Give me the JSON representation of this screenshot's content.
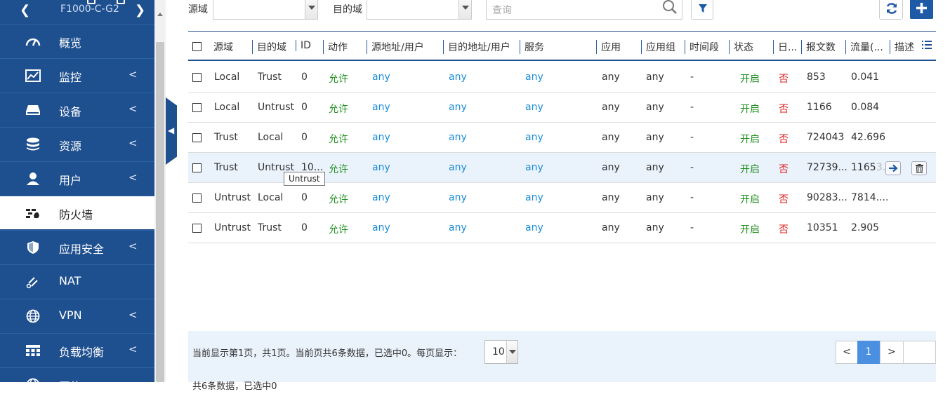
{
  "sidebar": {
    "device_name": "F1000-C-G2",
    "items": [
      {
        "label": "概览",
        "icon": "dashboard-gauge-icon",
        "has_chevron": false
      },
      {
        "label": "监控",
        "icon": "monitor-chart-icon",
        "has_chevron": true
      },
      {
        "label": "设备",
        "icon": "device-drive-icon",
        "has_chevron": true
      },
      {
        "label": "资源",
        "icon": "database-stack-icon",
        "has_chevron": true
      },
      {
        "label": "用户",
        "icon": "user-icon",
        "has_chevron": true
      },
      {
        "label": "防火墙",
        "icon": "firewall-icon",
        "has_chevron": false,
        "active": true
      },
      {
        "label": "应用安全",
        "icon": "shield-icon",
        "has_chevron": true
      },
      {
        "label": "NAT",
        "icon": "nat-link-icon",
        "has_chevron": false
      },
      {
        "label": "VPN",
        "icon": "globe-icon",
        "has_chevron": true
      },
      {
        "label": "负载均衡",
        "icon": "load-balance-icon",
        "has_chevron": true
      },
      {
        "label": "网络",
        "icon": "network-globe-icon",
        "has_chevron": false
      }
    ],
    "chevron": "<"
  },
  "filters": {
    "src_zone_label": "源域",
    "dst_zone_label": "目的域",
    "search_placeholder": "查询"
  },
  "table": {
    "headers": [
      "源域",
      "目的域",
      "ID",
      "动作",
      "源地址/用户",
      "目的地址/用户",
      "服务",
      "应用",
      "应用组",
      "时间段",
      "状态",
      "日...",
      "报文数",
      "流量(...",
      "描述"
    ],
    "rows": [
      {
        "src": "Local",
        "dst": "Trust",
        "id": "0",
        "action": "允许",
        "srcaddr": "any",
        "dstaddr": "any",
        "service": "any",
        "app": "any",
        "appgroup": "any",
        "time": "-",
        "status": "开启",
        "log": "否",
        "packets": "853",
        "traffic": "0.041",
        "desc": ""
      },
      {
        "src": "Local",
        "dst": "Untrust",
        "id": "0",
        "action": "允许",
        "srcaddr": "any",
        "dstaddr": "any",
        "service": "any",
        "app": "any",
        "appgroup": "any",
        "time": "-",
        "status": "开启",
        "log": "否",
        "packets": "1166",
        "traffic": "0.084",
        "desc": ""
      },
      {
        "src": "Trust",
        "dst": "Local",
        "id": "0",
        "action": "允许",
        "srcaddr": "any",
        "dstaddr": "any",
        "service": "any",
        "app": "any",
        "appgroup": "any",
        "time": "-",
        "status": "开启",
        "log": "否",
        "packets": "724043",
        "traffic": "42.696",
        "desc": ""
      },
      {
        "src": "Trust",
        "dst": "Untrust",
        "id": "10...",
        "action": "允许",
        "srcaddr": "any",
        "dstaddr": "any",
        "service": "any",
        "app": "any",
        "appgroup": "any",
        "time": "-",
        "status": "开启",
        "log": "否",
        "packets": "72739...",
        "traffic": "1165",
        "traffic_faded": "3.",
        "desc": ""
      },
      {
        "src": "Untrust",
        "dst": "Local",
        "id": "0",
        "action": "允许",
        "srcaddr": "any",
        "dstaddr": "any",
        "service": "any",
        "app": "any",
        "appgroup": "any",
        "time": "-",
        "status": "开启",
        "log": "否",
        "packets": "90283...",
        "traffic": "7814....",
        "desc": ""
      },
      {
        "src": "Untrust",
        "dst": "Trust",
        "id": "0",
        "action": "允许",
        "srcaddr": "any",
        "dstaddr": "any",
        "service": "any",
        "app": "any",
        "appgroup": "any",
        "time": "-",
        "status": "开启",
        "log": "否",
        "packets": "10351",
        "traffic": "2.905",
        "desc": ""
      }
    ],
    "tooltip": "Untrust"
  },
  "footer": {
    "summary": "当前显示第1页，共1页。当前页共6条数据，已选中0。每页显示：",
    "page_size": "10",
    "prev": "<",
    "current_page": "1",
    "next": ">",
    "summary2": "共6条数据，已选中0"
  },
  "colors": {
    "sidebar_bg": "#1e4f8f",
    "accent": "#1f5aa6",
    "allow_green": "#1f8f1f",
    "link_blue": "#1a8bd8",
    "no_red": "#e02020",
    "highlight_row": "#eaf2fb"
  }
}
